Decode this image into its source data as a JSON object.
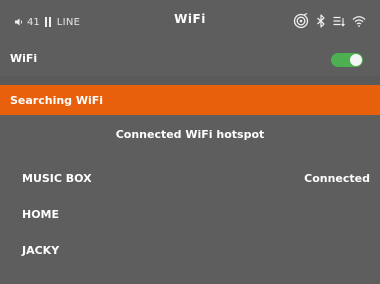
{
  "status_bar": {
    "signal_number": "41",
    "carrier": "LINE",
    "title": "WiFi",
    "icons": [
      "speaker-icon",
      "signal-bars-icon",
      "target-icon",
      "bluetooth-icon",
      "menu-sort-icon",
      "wifi-icon"
    ]
  },
  "wifi_setting": {
    "label": "WiFi",
    "toggle_on": true,
    "toggle_color": "#4caf50"
  },
  "searching": {
    "label": "Searching WiFi",
    "color": "#e8600c"
  },
  "section": {
    "title": "Connected  WiFi hotspot"
  },
  "networks": [
    {
      "name": "MUSIC BOX",
      "status": "Connected"
    },
    {
      "name": "HOME",
      "status": ""
    },
    {
      "name": "JACKY",
      "status": ""
    }
  ],
  "colors": {
    "background": "#5e5e5e",
    "text": "#ffffff"
  }
}
